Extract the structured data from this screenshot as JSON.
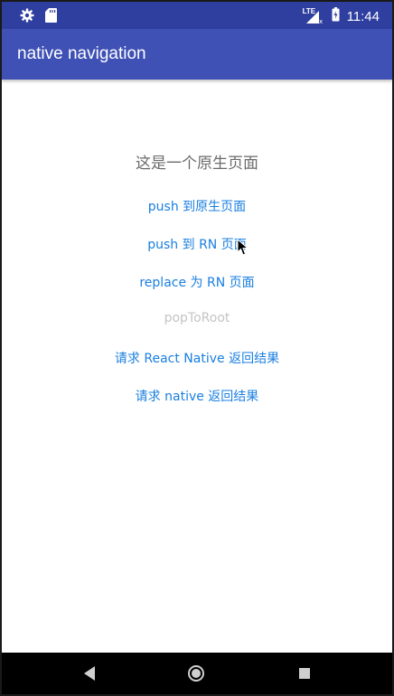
{
  "status_bar": {
    "time": "11:44",
    "network": "LTE",
    "icons": [
      "gear-icon",
      "sd-card-icon",
      "signal-icon",
      "battery-charging-icon"
    ]
  },
  "toolbar": {
    "title": "native navigation"
  },
  "page": {
    "heading": "这是一个原生页面",
    "actions": [
      {
        "label": "push 到原生页面",
        "enabled": true
      },
      {
        "label": "push 到 RN 页面",
        "enabled": true
      },
      {
        "label": "replace 为 RN 页面",
        "enabled": true
      },
      {
        "label": "popToRoot",
        "enabled": false
      },
      {
        "label": "请求 React Native 返回结果",
        "enabled": true
      },
      {
        "label": "请求 native 返回结果",
        "enabled": true
      }
    ]
  },
  "nav_bar": {
    "buttons": [
      "back-icon",
      "home-icon",
      "recents-icon"
    ]
  },
  "colors": {
    "status_bar": "#2f3fa0",
    "toolbar": "#3f51b5",
    "link": "#1a7fe0",
    "disabled": "#c4c4c4",
    "heading": "#6b6b6b"
  }
}
